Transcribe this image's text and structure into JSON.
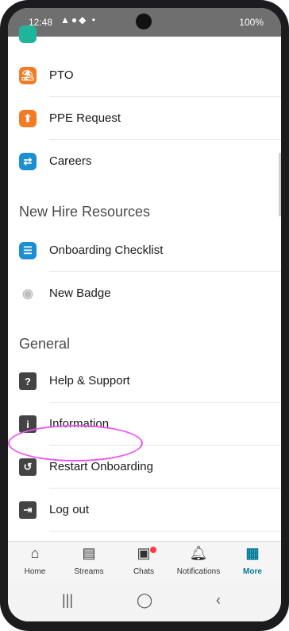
{
  "status": {
    "time": "12:48",
    "right": "100%"
  },
  "menu": {
    "items_top": [
      {
        "label": "PTO",
        "icon": "pto-icon",
        "color": "#f17c24"
      },
      {
        "label": "PPE Request",
        "icon": "ppe-request-icon",
        "color": "#f17c24"
      },
      {
        "label": "Careers",
        "icon": "careers-icon",
        "color": "#1a8fd1"
      }
    ],
    "section_new_hire": "New Hire Resources",
    "items_new_hire": [
      {
        "label": "Onboarding Checklist",
        "icon": "checklist-icon",
        "color": "#1a8fd1"
      },
      {
        "label": "New Badge",
        "icon": "badge-icon",
        "color": "#c9c9c9"
      }
    ],
    "section_general": "General",
    "items_general": [
      {
        "label": "Help & Support",
        "icon": "help-icon",
        "color": "#444444"
      },
      {
        "label": "Information",
        "icon": "info-icon",
        "color": "#444444"
      },
      {
        "label": "Restart Onboarding",
        "icon": "restart-icon",
        "color": "#444444"
      },
      {
        "label": "Log out",
        "icon": "logout-icon",
        "color": "#444444"
      }
    ]
  },
  "tabs": [
    {
      "label": "Home",
      "icon": "home-icon"
    },
    {
      "label": "Streams",
      "icon": "streams-icon"
    },
    {
      "label": "Chats",
      "icon": "chats-icon"
    },
    {
      "label": "Notifications",
      "icon": "notifications-icon"
    },
    {
      "label": "More",
      "icon": "more-icon",
      "active": true
    }
  ]
}
